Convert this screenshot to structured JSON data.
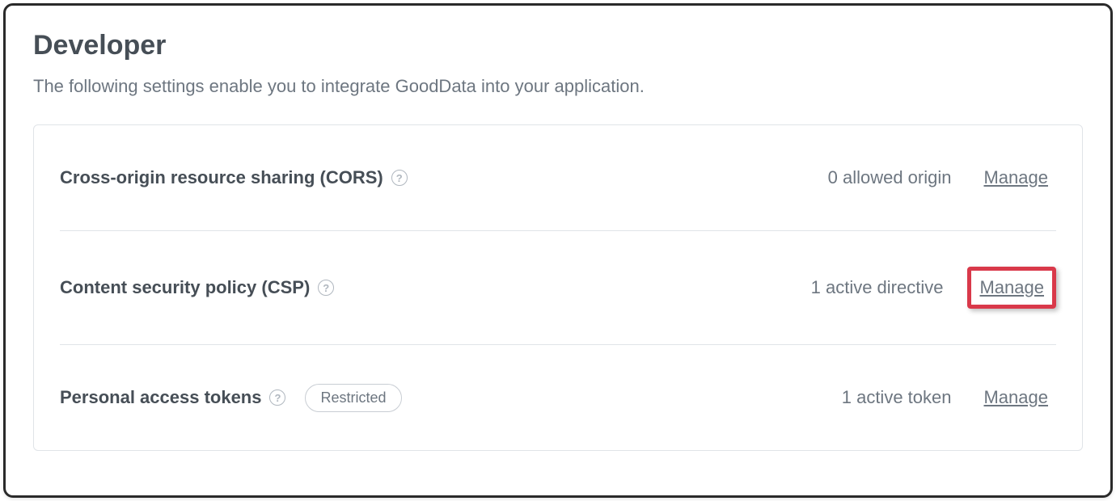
{
  "header": {
    "title": "Developer",
    "description": "The following settings enable you to integrate GoodData into your application."
  },
  "settings": {
    "cors": {
      "title": "Cross-origin resource sharing (CORS)",
      "status": "0 allowed origin",
      "manage": "Manage"
    },
    "csp": {
      "title": "Content security policy (CSP)",
      "status": "1 active directive",
      "manage": "Manage"
    },
    "pat": {
      "title": "Personal access tokens",
      "badge": "Restricted",
      "status": "1 active token",
      "manage": "Manage"
    }
  }
}
